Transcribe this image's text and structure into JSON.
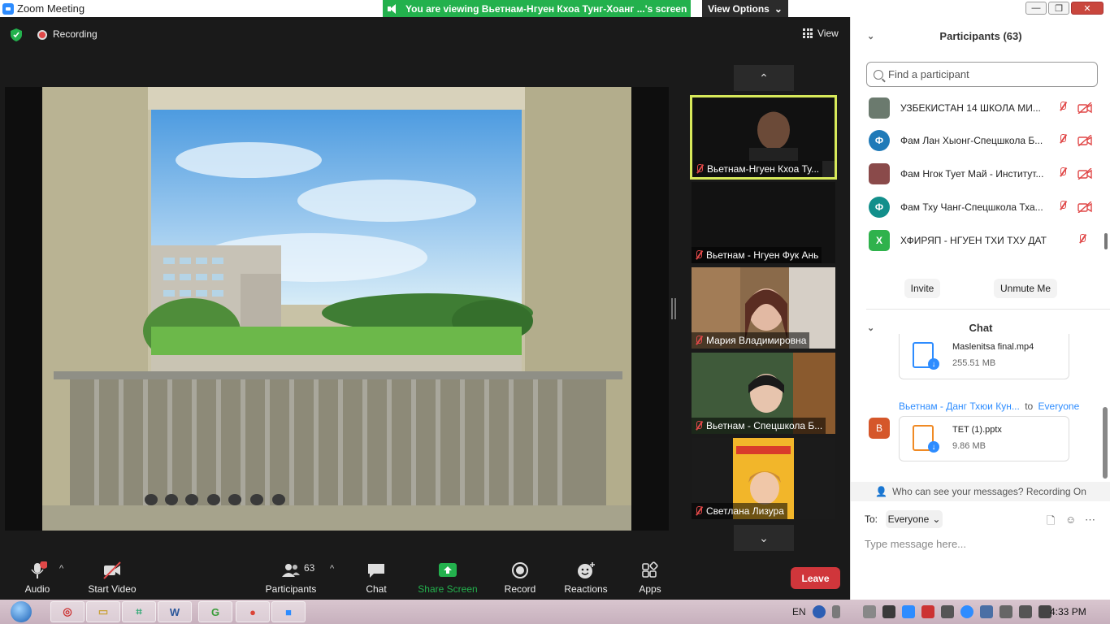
{
  "window": {
    "title": "Zoom Meeting",
    "share_banner": "You are viewing Вьетнам-Нгуен Кхоа Тунг-Хоанг ...'s screen",
    "view_options": "View Options",
    "minimize": "—",
    "maximize": "❐",
    "close": "✕"
  },
  "meeting": {
    "recording_label": "Recording",
    "view_label": "View"
  },
  "thumbnails": [
    {
      "name": "Вьетнам-Нгуен Кхоа Ту...",
      "active": true
    },
    {
      "name": "Вьетнам - Нгуен Фук Ань",
      "active": false
    },
    {
      "name": "Мария Владимировна",
      "active": false
    },
    {
      "name": "Вьетнам - Спецшкола Б...",
      "active": false
    },
    {
      "name": "Светлана Лизура",
      "active": false
    }
  ],
  "thumb_nav": {
    "up": "⌃",
    "down": "⌄"
  },
  "toolbar": {
    "audio": "Audio",
    "start_video": "Start Video",
    "participants": "Participants",
    "participants_count": "63",
    "chat": "Chat",
    "share_screen": "Share Screen",
    "record": "Record",
    "reactions": "Reactions",
    "apps": "Apps",
    "leave": "Leave",
    "audio_badge": "!"
  },
  "participants_panel": {
    "title": "Participants (63)",
    "search_placeholder": "Find a participant",
    "items": [
      {
        "name": "УЗБЕКИСТАН 14 ШКОЛА МИ...",
        "avatar": "",
        "avatar_color": "#6b7a6e",
        "video_off": true
      },
      {
        "name": "Фам Лан Хыонг-Спецшкола Б...",
        "avatar": "Ф",
        "avatar_color": "#1f7ab8",
        "video_off": true
      },
      {
        "name": "Фам Нгок Тует Май - Институт...",
        "avatar": "",
        "avatar_color": "#8a4a4a",
        "video_off": true
      },
      {
        "name": "Фам Тху Чанг-Спецшкола Тха...",
        "avatar": "Ф",
        "avatar_color": "#128f8b",
        "video_off": true
      },
      {
        "name": "ХФИРЯП - НГУЕН ТХИ ТХУ ДАТ",
        "avatar": "X",
        "avatar_color": "#2fb24c",
        "video_off": false
      }
    ],
    "invite": "Invite",
    "unmute_me": "Unmute Me"
  },
  "chat_panel": {
    "title": "Chat",
    "messages": [
      {
        "sender": "",
        "recipient": "",
        "file_name": "Maslenitsa final.mp4",
        "file_size": "255.51 MB",
        "file_color": "#2d8cff"
      },
      {
        "sender": "Вьетнам - Данг Тхюи Кун...",
        "to": "to",
        "recipient": "Everyone",
        "avatar": "В",
        "file_name": "TET (1).pptx",
        "file_size": "9.86 MB",
        "file_color": "#f08a24"
      }
    ],
    "who_can_see": "Who can see your messages? Recording On",
    "to_label": "To:",
    "to_value": "Everyone",
    "input_placeholder": "Type message here..."
  },
  "taskbar": {
    "lang": "EN",
    "time": "4:33 PM"
  },
  "colors": {
    "accent": "#2d8cff",
    "share_green": "#23b14d",
    "leave_red": "#d0363b",
    "active_tile_border": "#d7e95a"
  }
}
